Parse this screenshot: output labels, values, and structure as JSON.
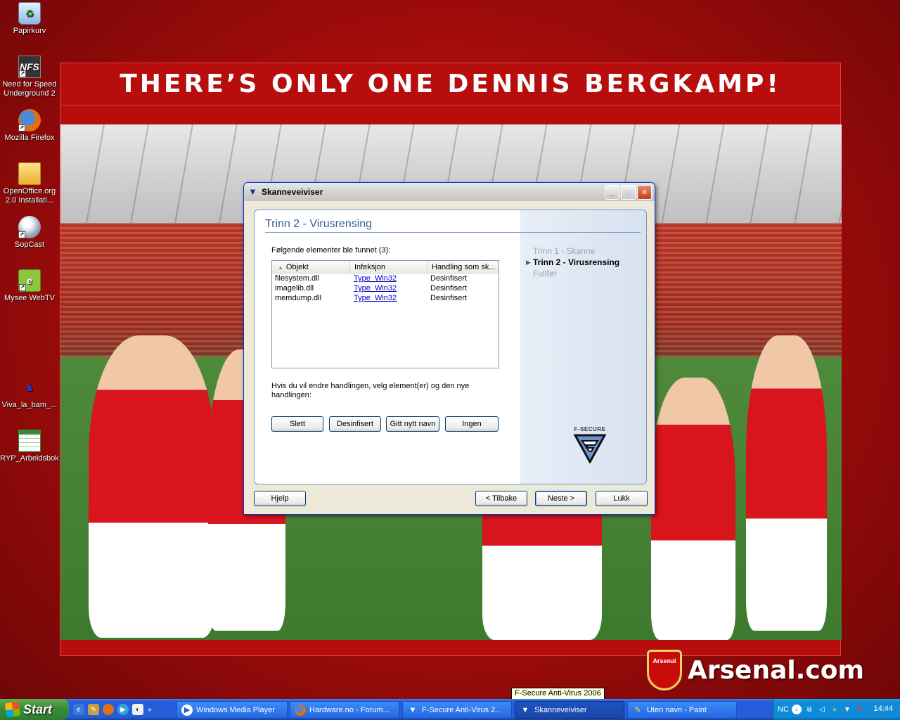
{
  "desktop": {
    "icons": [
      {
        "label": "Papirkurv",
        "icon": "recycle-bin-icon"
      },
      {
        "label": "Need for Speed Underground 2",
        "icon": "nfs-icon",
        "glyph": "NFS"
      },
      {
        "label": "Mozilla Firefox",
        "icon": "firefox-icon"
      },
      {
        "label": "OpenOffice.org 2.0 Installati...",
        "icon": "folder-icon"
      },
      {
        "label": "SopCast",
        "icon": "sopcast-icon"
      },
      {
        "label": "Mysee WebTV",
        "icon": "mysee-icon"
      },
      {
        "label": "Viva_la_bam_...",
        "icon": "viva-la-bam-icon"
      },
      {
        "label": "RYP_Arbeidsbok",
        "icon": "spreadsheet-icon"
      }
    ],
    "shortcut_glyph": "↗"
  },
  "wallpaper": {
    "headline": "THERE’S ONLY ONE DENNIS BERGKAMP!",
    "crest_text": "Arsenal",
    "logo_text": "Arsenal.com",
    "colors": {
      "red": "#b70d0d",
      "white": "#ffffff"
    }
  },
  "window": {
    "title": "Skanneveiviser",
    "controls": {
      "minimize": "_",
      "maximize": "□",
      "close": "✕"
    },
    "step_title": "Trinn 2 - Virusrensing",
    "found_label": "Følgende elementer ble funnet (3):",
    "list": {
      "columns": [
        "Objekt",
        "Infeksjon",
        "Handling som sk..."
      ],
      "rows": [
        {
          "object": "filesystem.dll",
          "infection": "Type_Win32",
          "action": "Desinfisert"
        },
        {
          "object": "imagelib.dll",
          "infection": "Type_Win32",
          "action": "Desinfisert"
        },
        {
          "object": "memdump.dll",
          "infection": "Type_Win32",
          "action": "Desinfisert"
        }
      ]
    },
    "hint": "Hvis du vil endre handlingen, velg element(er) og den nye handlingen:",
    "action_buttons": {
      "delete": "Slett",
      "disinfect": "Desinfisert",
      "rename": "Gitt nytt navn",
      "none": "Ingen"
    },
    "steps": {
      "step1": "Trinn 1 - Skanne",
      "step2": "Trinn 2 - Virusrensing",
      "step3": "Fullfør"
    },
    "brand_text": "F-SECURE",
    "footer_buttons": {
      "help": "Hjelp",
      "back": "< Tilbake",
      "next": "Neste >",
      "close": "Lukk"
    },
    "accent_color": "#3a5a9a"
  },
  "tooltip": "F-Secure Anti-Virus 2006",
  "taskbar": {
    "start_label": "Start",
    "tasks": [
      {
        "label": "Windows Media Player",
        "icon": "media-player-icon"
      },
      {
        "label": "Hardware.no - Forum...",
        "icon": "firefox-icon"
      },
      {
        "label": "F-Secure Anti-Virus 2...",
        "icon": "fsecure-icon"
      },
      {
        "label": "Skanneveiviser",
        "icon": "fsecure-icon"
      },
      {
        "label": "Uten navn - Paint",
        "icon": "paint-icon"
      }
    ],
    "tray": {
      "language": "NC",
      "clock": "14:44"
    }
  }
}
